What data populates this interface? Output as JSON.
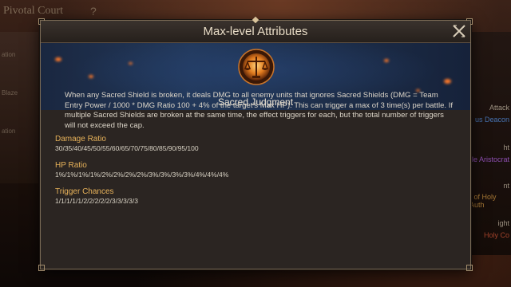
{
  "background": {
    "title": "Pivotal Court",
    "help": "?",
    "left_labels": [
      "ation",
      "Blaze",
      "ation"
    ],
    "right_labels": [
      {
        "text": "Attack",
        "color": "#d8cdb8"
      },
      {
        "text": "us Deacon",
        "color": "#5aa0ff"
      },
      {
        "text": "ht",
        "color": "#d8cdb8"
      },
      {
        "text": "le Aristocrat",
        "color": "#c36cff"
      },
      {
        "text": "nt",
        "color": "#d8cdb8"
      },
      {
        "text": "r of Holy Auth",
        "color": "#e8a94a"
      },
      {
        "text": "ight",
        "color": "#d8cdb8"
      },
      {
        "text": "Holy Co",
        "color": "#e05a3a"
      }
    ]
  },
  "modal": {
    "title": "Max-level Attributes",
    "skill_name": "Sacred Judgment",
    "emblem_icon": "scales-of-justice-icon",
    "description": "When any Sacred Shield is broken, it deals DMG to all enemy units that ignores Sacred Shields (DMG = Team Entry Power / 1000 * DMG Ratio 100 + 4% of the target's Max HP). This can trigger a max of 3 time(s) per battle. If multiple Sacred Shields are broken at the same time, the effect triggers for each, but the total number of triggers will not exceed the cap.",
    "stats": [
      {
        "label": "Damage Ratio",
        "value": "30/35/40/45/50/55/60/65/70/75/80/85/90/95/100"
      },
      {
        "label": "HP Ratio",
        "value": "1%/1%/1%/1%/2%/2%/2%/2%/3%/3%/3%/3%/4%/4%/4%"
      },
      {
        "label": "Trigger Chances",
        "value": "1/1/1/1/1/2/2/2/2/2/3/3/3/3/3"
      }
    ],
    "close_icon": "close-x-icon",
    "accent_color": "#e7b25a"
  }
}
